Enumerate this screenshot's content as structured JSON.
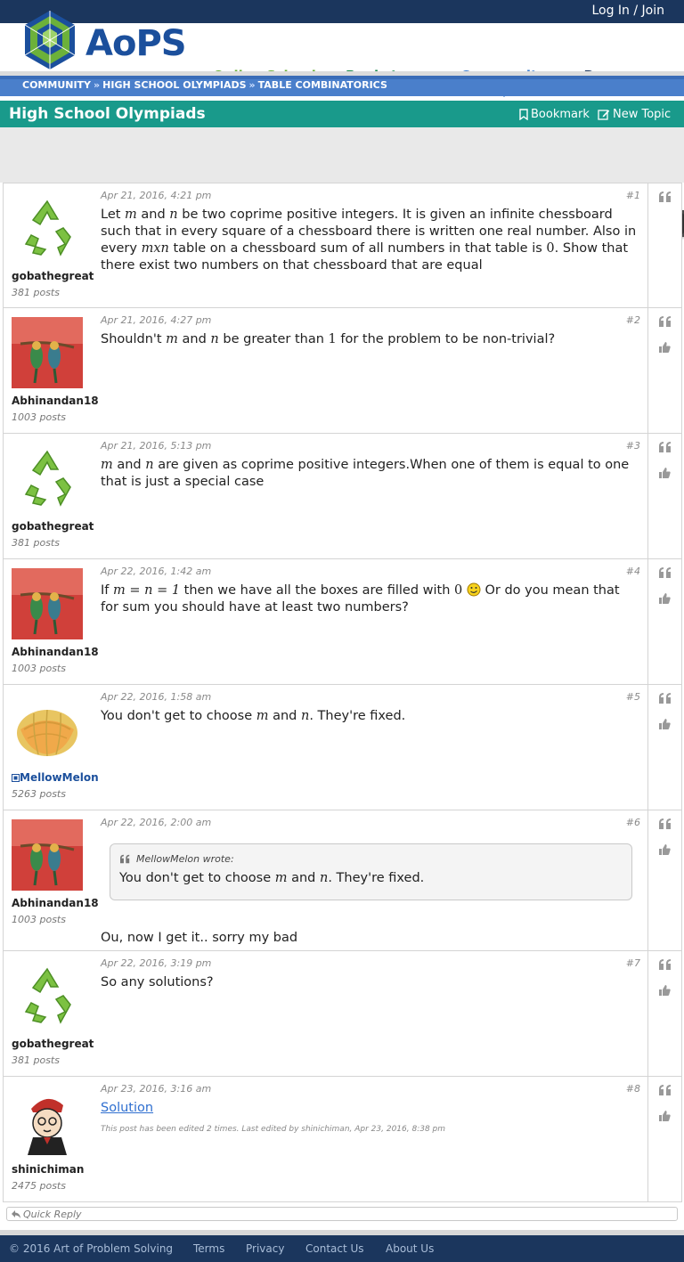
{
  "top": {
    "login_label": "Log In / Join"
  },
  "brand": {
    "name": "AoPS"
  },
  "nav": [
    {
      "label": "Online School"
    },
    {
      "label": "Bookstore"
    },
    {
      "label": "Community"
    },
    {
      "label": "Resources"
    }
  ],
  "breadcrumb": [
    "COMMUNITY",
    "HIGH SCHOOL OLYMPIADS",
    "TABLE COMBINATORICS"
  ],
  "breadcrumb_sep": "»",
  "forum": {
    "title": "High School Olympiads",
    "bookmark_label": "Bookmark",
    "new_topic_label": "New Topic"
  },
  "posts": [
    {
      "user": "gobathegreat",
      "post_count": "381 posts",
      "date": "Apr 21, 2016, 4:21 pm",
      "number": "#1",
      "text": [
        "Let",
        "m",
        "and",
        "n",
        "be two coprime positive integers. It is given an infinite chessboard",
        "such that in every square of a chessboard there is written one real number. Also",
        "in every",
        "mxn",
        "table on a chessboard sum of all numbers in that table is",
        "0",
        ". Show",
        "that there exist two numbers on that chessboard that are equal"
      ]
    },
    {
      "user": "Abhinandan18",
      "post_count": "1003 posts",
      "date": "Apr 21, 2016, 4:27 pm",
      "number": "#2",
      "text": [
        "Shouldn't",
        "m",
        "and",
        "n",
        "be greater than",
        "1",
        "for the problem to be non-trivial?"
      ]
    },
    {
      "user": "gobathegreat",
      "post_count": "381 posts",
      "date": "Apr 21, 2016, 5:13 pm",
      "number": "#3",
      "text": [
        "m",
        "and",
        "n",
        "are given as coprime positive integers.When one of them is equal to",
        "one that is just a special case"
      ]
    },
    {
      "user": "Abhinandan18",
      "post_count": "1003 posts",
      "date": "Apr 22, 2016, 1:42 am",
      "number": "#4",
      "text": [
        "If",
        "m = n = 1",
        "then we have all the boxes are filled with",
        "0",
        "Or do you mean",
        "that for sum you should have at least two numbers?"
      ]
    },
    {
      "user": "MellowMelon",
      "post_count": "5263 posts",
      "date": "Apr 22, 2016, 1:58 am",
      "number": "#5",
      "text": [
        "You don't get to choose",
        "m",
        "and",
        "n",
        ". They're fixed."
      ]
    },
    {
      "user": "Abhinandan18",
      "post_count": "1003 posts",
      "date": "Apr 22, 2016, 2:00 am",
      "number": "#6",
      "quote_author": "MellowMelon wrote:",
      "quote_text": [
        "You don't get to choose",
        "m",
        "and",
        "n",
        ". They're fixed."
      ],
      "text": [
        "Ou, now I get it.. sorry my bad"
      ]
    },
    {
      "user": "gobathegreat",
      "post_count": "381 posts",
      "date": "Apr 22, 2016, 3:19 pm",
      "number": "#7",
      "text": [
        "So any solutions?"
      ]
    },
    {
      "user": "shinichiman",
      "post_count": "2475 posts",
      "date": "Apr 23, 2016, 3:16 am",
      "number": "#8",
      "link_text": "Solution",
      "edit_note": "This post has been edited 2 times. Last edited by shinichiman, Apr 23, 2016, 8:38 pm"
    }
  ],
  "quick_reply": "Quick Reply",
  "footer": {
    "copyright": "© 2016 Art of Problem Solving",
    "links": [
      "Terms",
      "Privacy",
      "Contact Us",
      "About Us"
    ]
  },
  "colors": {
    "navy": "#1b365d",
    "teal": "#199a8b",
    "breadcrumb_blue": "#4a7fcb",
    "online_green": "#6cb13a",
    "bookstore_green": "#198a4b",
    "community_blue": "#3a7cd0"
  },
  "icons": [
    "quote-icon",
    "thumbs-up-icon",
    "bookmark-icon",
    "edit-icon",
    "globe-icon",
    "reply-icon",
    "smiley-icon"
  ]
}
